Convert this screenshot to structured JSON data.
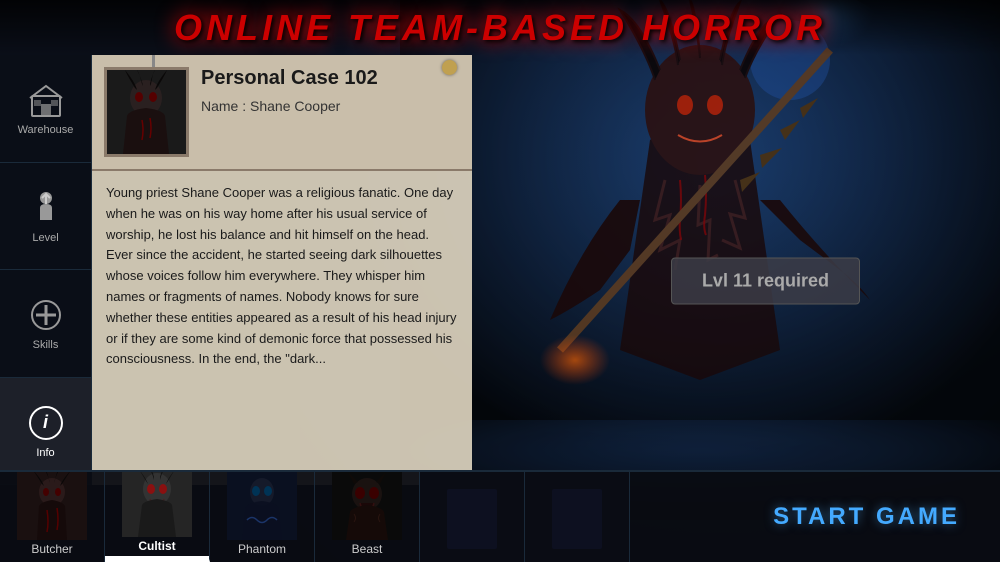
{
  "app": {
    "title": "ONLINE TEAM-BASED HORROR"
  },
  "sidebar": {
    "items": [
      {
        "id": "warehouse",
        "label": "Warehouse",
        "icon": "warehouse-icon",
        "active": false
      },
      {
        "id": "level",
        "label": "Level",
        "icon": "level-icon",
        "active": false
      },
      {
        "id": "skills",
        "label": "Skills",
        "icon": "skills-icon",
        "active": false
      },
      {
        "id": "info",
        "label": "Info",
        "icon": "info-icon",
        "active": true
      }
    ]
  },
  "case": {
    "title": "Personal Case 102",
    "name_label": "Name :",
    "name_value": "Shane Cooper",
    "story": "Young priest Shane Cooper was a religious fanatic. One day when he was on his way home after his usual service of worship, he lost his balance and hit himself on the head. Ever since the accident, he started seeing dark silhouettes whose voices follow him everywhere. They whisper him names or fragments of names. Nobody knows for sure whether these entities appeared as a result of his head injury or if they are some kind of demonic force that possessed his consciousness. In the end, the \"dark..."
  },
  "level_badge": {
    "text": "Lvl 11 required"
  },
  "characters": [
    {
      "id": "butcher",
      "label": "Butcher",
      "active": false
    },
    {
      "id": "cultist",
      "label": "Cultist",
      "active": true
    },
    {
      "id": "phantom",
      "label": "Phantom",
      "active": false
    },
    {
      "id": "beast",
      "label": "Beast",
      "active": false
    }
  ],
  "start_button": {
    "label": "START GAME"
  }
}
